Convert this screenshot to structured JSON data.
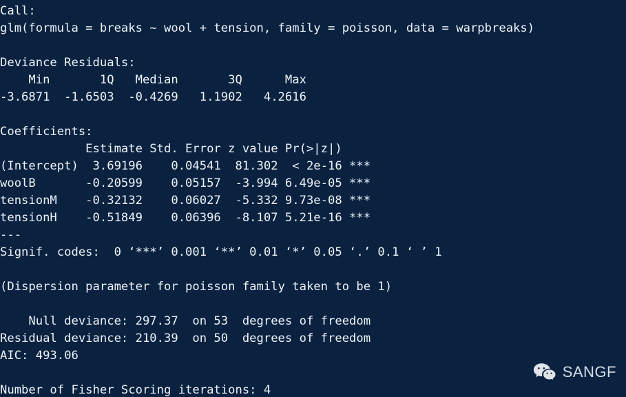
{
  "terminal": {
    "background_color": "#0a2240",
    "text_color": "#eef2f7",
    "lines": [
      "Call:",
      "glm(formula = breaks ~ wool + tension, family = poisson, data = warpbreaks)",
      "",
      "Deviance Residuals:",
      "    Min       1Q   Median       3Q      Max  ",
      "-3.6871  -1.6503  -0.4269   1.1902   4.2616  ",
      "",
      "Coefficients:",
      "            Estimate Std. Error z value Pr(>|z|)    ",
      "(Intercept)  3.69196    0.04541  81.302  < 2e-16 ***",
      "woolB       -0.20599    0.05157  -3.994 6.49e-05 ***",
      "tensionM    -0.32132    0.06027  -5.332 9.73e-08 ***",
      "tensionH    -0.51849    0.06396  -8.107 5.21e-16 ***",
      "---",
      "Signif. codes:  0 ‘***’ 0.001 ‘**’ 0.01 ‘*’ 0.05 ‘.’ 0.1 ‘ ’ 1",
      "",
      "(Dispersion parameter for poisson family taken to be 1)",
      "",
      "    Null deviance: 297.37  on 53  degrees of freedom",
      "Residual deviance: 210.39  on 50  degrees of freedom",
      "AIC: 493.06",
      "",
      "Number of Fisher Scoring iterations: 4"
    ],
    "call": {
      "label": "Call:",
      "formula": "glm(formula = breaks ~ wool + tension, family = poisson, data = warpbreaks)"
    },
    "deviance_residuals": {
      "label": "Deviance Residuals:",
      "headers": [
        "Min",
        "1Q",
        "Median",
        "3Q",
        "Max"
      ],
      "values": [
        "-3.6871",
        "-1.6503",
        "-0.4269",
        "1.1902",
        "4.2616"
      ]
    },
    "coefficients": {
      "label": "Coefficients:",
      "headers": [
        "",
        "Estimate",
        "Std. Error",
        "z value",
        "Pr(>|z|)",
        ""
      ],
      "rows": [
        {
          "term": "(Intercept)",
          "estimate": "3.69196",
          "std_error": "0.04541",
          "z_value": "81.302",
          "p_value": "< 2e-16",
          "signif": "***"
        },
        {
          "term": "woolB",
          "estimate": "-0.20599",
          "std_error": "0.05157",
          "z_value": "-3.994",
          "p_value": "6.49e-05",
          "signif": "***"
        },
        {
          "term": "tensionM",
          "estimate": "-0.32132",
          "std_error": "0.06027",
          "z_value": "-5.332",
          "p_value": "9.73e-08",
          "signif": "***"
        },
        {
          "term": "tensionH",
          "estimate": "-0.51849",
          "std_error": "0.06396",
          "z_value": "-8.107",
          "p_value": "5.21e-16",
          "signif": "***"
        }
      ],
      "separator": "---",
      "signif_codes": "Signif. codes:  0 ‘***’ 0.001 ‘**’ 0.01 ‘*’ 0.05 ‘.’ 0.1 ‘ ’ 1"
    },
    "dispersion": "(Dispersion parameter for poisson family taken to be 1)",
    "fit": {
      "null_deviance_line": "    Null deviance: 297.37  on 53  degrees of freedom",
      "residual_deviance_line": "Residual deviance: 210.39  on 50  degrees of freedom",
      "aic_line": "AIC: 493.06",
      "null_deviance": "297.37",
      "null_df": "53",
      "residual_deviance": "210.39",
      "residual_df": "50",
      "aic": "493.06"
    },
    "iterations_line": "Number of Fisher Scoring iterations: 4",
    "iterations": "4"
  },
  "watermark": {
    "icon": "wechat-icon",
    "label": "SANGF",
    "color": "#e8edf3"
  }
}
